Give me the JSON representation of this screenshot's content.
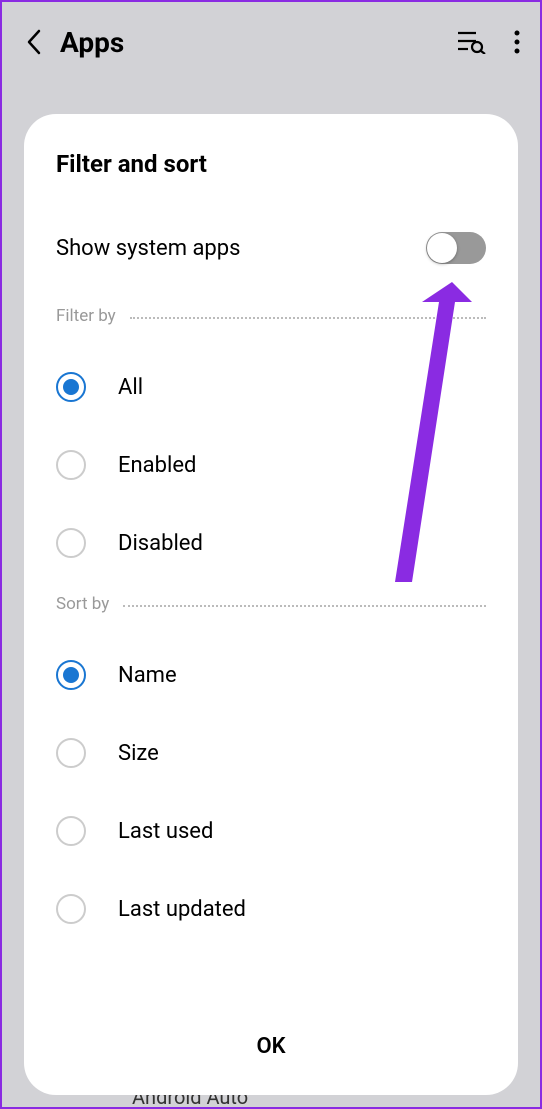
{
  "header": {
    "title": "Apps"
  },
  "modal": {
    "title": "Filter and sort",
    "toggle": {
      "label": "Show system apps",
      "enabled": false
    },
    "filter": {
      "section_label": "Filter by",
      "selected": "All",
      "options": [
        {
          "label": "All",
          "selected": true
        },
        {
          "label": "Enabled",
          "selected": false
        },
        {
          "label": "Disabled",
          "selected": false
        }
      ]
    },
    "sort": {
      "section_label": "Sort by",
      "selected": "Name",
      "options": [
        {
          "label": "Name",
          "selected": true
        },
        {
          "label": "Size",
          "selected": false
        },
        {
          "label": "Last used",
          "selected": false
        },
        {
          "label": "Last updated",
          "selected": false
        }
      ]
    },
    "ok_label": "OK"
  },
  "background": {
    "visible_app": "Android Auto"
  }
}
